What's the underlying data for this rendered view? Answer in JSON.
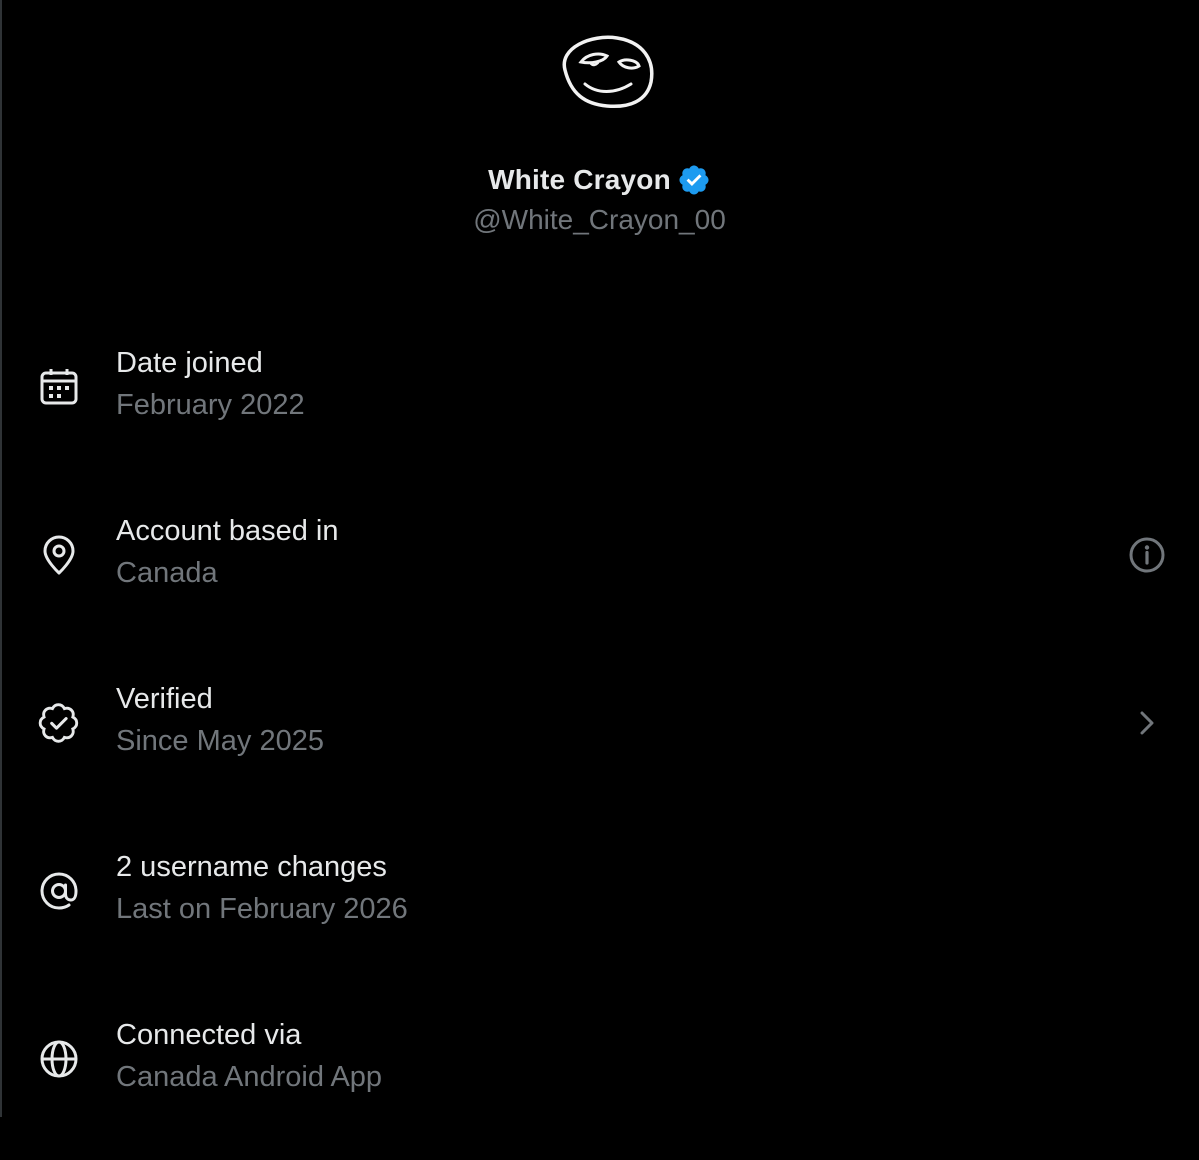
{
  "profile": {
    "display_name": "White Crayon",
    "handle": "@White_Crayon_00",
    "verified": true,
    "badge_color": "#1d9bf0"
  },
  "rows": [
    {
      "title": "Date joined",
      "subtitle": "February 2022",
      "icon": "calendar-icon",
      "trailing": null
    },
    {
      "title": "Account based in",
      "subtitle": "Canada",
      "icon": "location-pin-icon",
      "trailing": "info-icon"
    },
    {
      "title": "Verified",
      "subtitle": "Since May 2025",
      "icon": "verified-outline-icon",
      "trailing": "chevron-right-icon"
    },
    {
      "title": "2 username changes",
      "subtitle": "Last on February 2026",
      "icon": "at-sign-icon",
      "trailing": null
    },
    {
      "title": "Connected via",
      "subtitle": "Canada Android App",
      "icon": "globe-icon",
      "trailing": null
    }
  ],
  "colors": {
    "background": "#000000",
    "primary_text": "#e7e9ea",
    "secondary_text": "#71767b",
    "accent": "#1d9bf0"
  }
}
